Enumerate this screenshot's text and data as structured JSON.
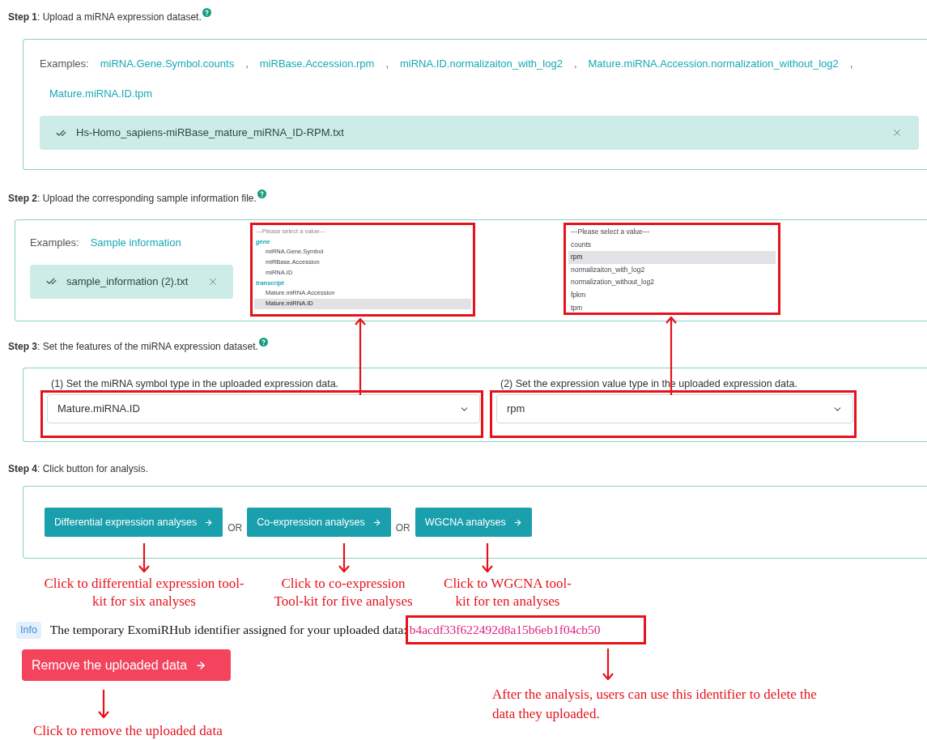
{
  "step1": {
    "heading": "**Step 1**: Upload a miRNA expression dataset.",
    "examples_label": "Examples:",
    "examples": [
      {
        "text": "miRNA.Gene.Symbol.counts",
        "separator": ","
      },
      {
        "text": "miRBase.Accession.rpm",
        "separator": ","
      },
      {
        "text": "miRNA.ID.normalizaiton_with_log2",
        "separator": ","
      },
      {
        "text": "Mature.miRNA.Accession.normalization_without_log2",
        "separator": ","
      },
      {
        "text": "Mature.miRNA.ID.tpm"
      }
    ],
    "file": "Hs-Homo_sapiens-miRBase_mature_miRNA_ID-RPM.txt"
  },
  "step2": {
    "heading": "**Step 2**: Upload the corresponding sample information file.",
    "examples_label": "Examples:",
    "example": "Sample information",
    "file": "sample_information (2).txt",
    "symbol_list": {
      "placeholder": "---Please select a value---",
      "groups": [
        {
          "label": "gene",
          "options": [
            {
              "text": "miRNA.Gene.Symbol",
              "selected": false
            },
            {
              "text": "miRBase.Accession",
              "selected": false
            },
            {
              "text": "miRNA.ID",
              "selected": false
            }
          ]
        },
        {
          "label": "transcript",
          "options": [
            {
              "text": "Mature.miRNA.Accession",
              "selected": false
            },
            {
              "text": "Mature.miRNA.ID",
              "selected": true
            }
          ]
        }
      ]
    },
    "value_list": {
      "placeholder": "---Please select a value---",
      "options": [
        {
          "text": "counts",
          "selected": false
        },
        {
          "text": "rpm",
          "selected": true
        },
        {
          "text": "normalizaiton_with_log2",
          "selected": false
        },
        {
          "text": "normalization_without_log2",
          "selected": false
        },
        {
          "text": "fpkm",
          "selected": false
        },
        {
          "text": "tpm",
          "selected": false
        }
      ]
    }
  },
  "step3": {
    "heading": "**Step 3**: Set the features of the miRNA expression dataset.",
    "fields": [
      {
        "label": "(1) Set the miRNA symbol type in the uploaded expression data.",
        "value": "Mature.miRNA.ID"
      },
      {
        "label": "(2) Set the expression value type in the uploaded expression data.",
        "value": "rpm"
      }
    ]
  },
  "step4": {
    "heading": "**Step 4**: Click button for analysis.",
    "buttons": [
      {
        "label": "Differential expression analyses",
        "separator": "OR"
      },
      {
        "label": "Co-expression analyses",
        "separator": "OR"
      },
      {
        "label": "WGCNA analyses"
      }
    ]
  },
  "button_notes": [
    {
      "lines": [
        "Click to differential expression tool-",
        "kit for six analyses"
      ]
    },
    {
      "lines": [
        "Click to co-expression",
        "Tool-kit for five analyses"
      ]
    },
    {
      "lines": [
        "Click to WGCNA tool-",
        "kit for ten analyses"
      ]
    }
  ],
  "info": {
    "badge": "Info",
    "text": "The temporary ExomiRHub identifier assigned for your uploaded data:",
    "identifier": "b4acdf33f622492d8a15b6eb1f04cb50"
  },
  "remove_button": "Remove the uploaded data",
  "identifier_note": {
    "lines": [
      "After the analysis, users can use this identifier to delete the",
      "data they uploaded."
    ]
  },
  "remove_note": "Click to remove the uploaded data"
}
